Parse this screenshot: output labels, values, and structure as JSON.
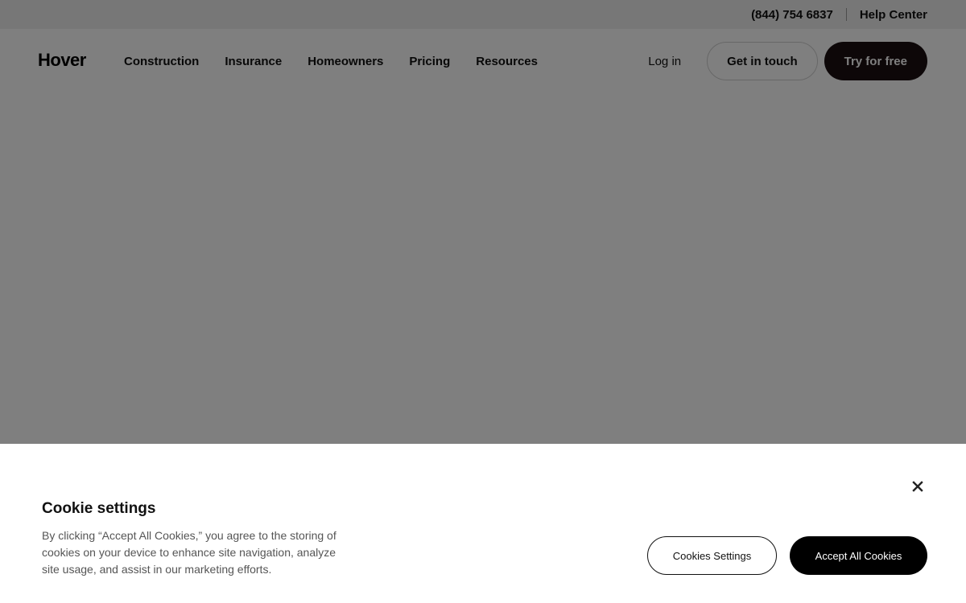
{
  "utility_bar": {
    "phone": "(844) 754 6837",
    "help_center": "Help Center"
  },
  "nav": {
    "logo": "Hover",
    "items": [
      {
        "label": "Construction"
      },
      {
        "label": "Insurance"
      },
      {
        "label": "Homeowners"
      },
      {
        "label": "Pricing"
      },
      {
        "label": "Resources"
      }
    ],
    "login": "Log in",
    "get_in_touch": "Get in touch",
    "try_free": "Try for free"
  },
  "cookie": {
    "title": "Cookie settings",
    "text": "By clicking “Accept All Cookies,” you agree to the storing of cookies on your device to enhance site navigation, analyze site usage, and assist in our marketing efforts.",
    "settings_button": "Cookies Settings",
    "accept_button": "Accept All Cookies",
    "close_icon": "close-icon"
  },
  "colors": {
    "overlay": "#000000",
    "primary_dark": "#1a0f10",
    "banner_bg": "#ffffff"
  }
}
